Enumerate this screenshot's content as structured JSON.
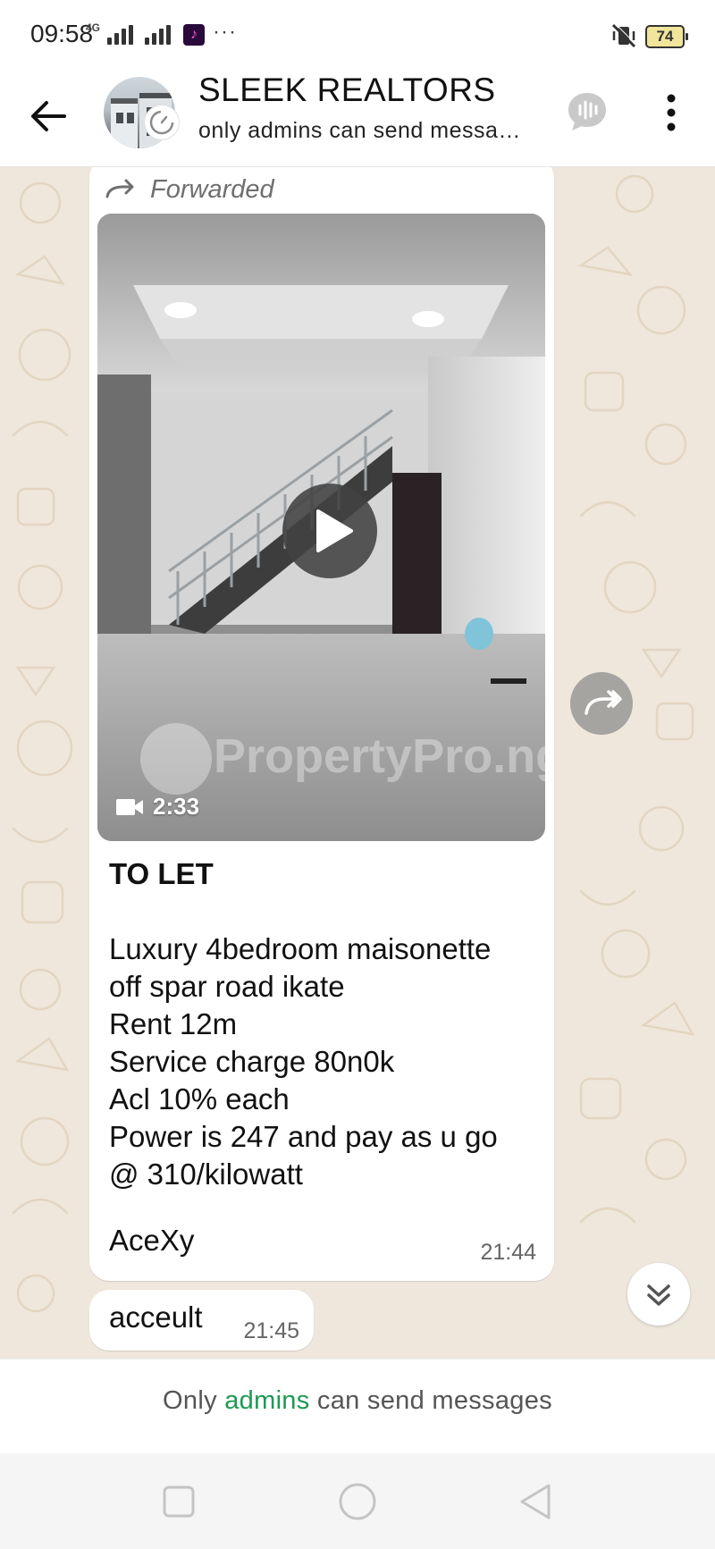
{
  "status_bar": {
    "time": "09:58",
    "network": "4G",
    "battery": "74",
    "overflow": "···",
    "icons": [
      "music-app-icon",
      "signal-icon",
      "mute-vibrate-icon",
      "battery-icon"
    ]
  },
  "header": {
    "title": "SLEEK REALTORS",
    "subtitle": "only admins can send messages",
    "icons": [
      "back-arrow-icon",
      "group-avatar",
      "voice-chat-icon",
      "more-options-icon"
    ]
  },
  "messages": [
    {
      "forwarded_label": "Forwarded",
      "video_duration": "2:33",
      "video_watermark": "PropertyPro.ng",
      "heading": "TO LET",
      "lines": [
        "Luxury 4bedroom  maisonette",
        "off spar road ikate",
        "Rent 12m",
        "Service charge 80n0k",
        "Acl  10% each",
        "Power is 247 and pay as u go",
        "@ 310/kilowatt"
      ],
      "signature": "AceXy",
      "time": "21:44"
    },
    {
      "text": "acceult",
      "time": "21:45"
    }
  ],
  "footer": {
    "prefix": "Only",
    "link": "admins",
    "suffix": "can send messages"
  },
  "colors": {
    "chat_background": "#efe7dc",
    "accent_green": "#1c9a52",
    "bubble": "#ffffff"
  }
}
